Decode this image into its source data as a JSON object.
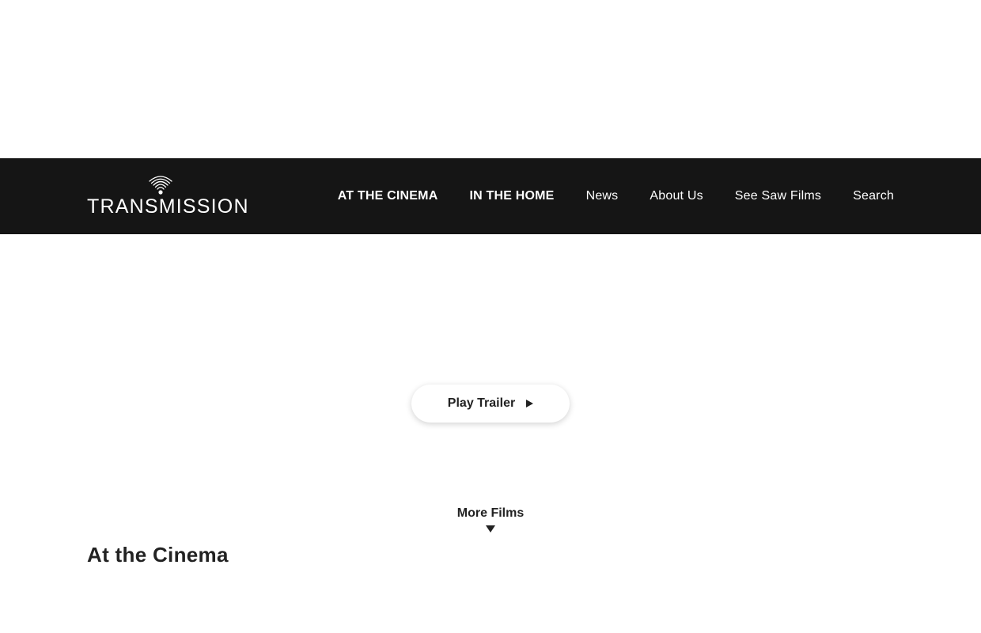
{
  "brand": {
    "name": "TRANSMISSION",
    "logo_icon": "wifi-signal-icon"
  },
  "nav": {
    "items": [
      {
        "label": "AT THE CINEMA"
      },
      {
        "label": "IN THE HOME"
      },
      {
        "label": "News"
      },
      {
        "label": "About Us"
      },
      {
        "label": "See Saw Films"
      },
      {
        "label": "Search"
      }
    ]
  },
  "hero": {
    "play_label": "Play Trailer",
    "play_icon": "play-icon"
  },
  "more_films": {
    "label": "More Films",
    "icon": "chevron-down-icon"
  },
  "section": {
    "title": "At the Cinema"
  },
  "colors": {
    "navbar_bg": "#151515",
    "nav_text": "#ffffff",
    "body_text": "#222222",
    "page_bg": "#ffffff"
  }
}
